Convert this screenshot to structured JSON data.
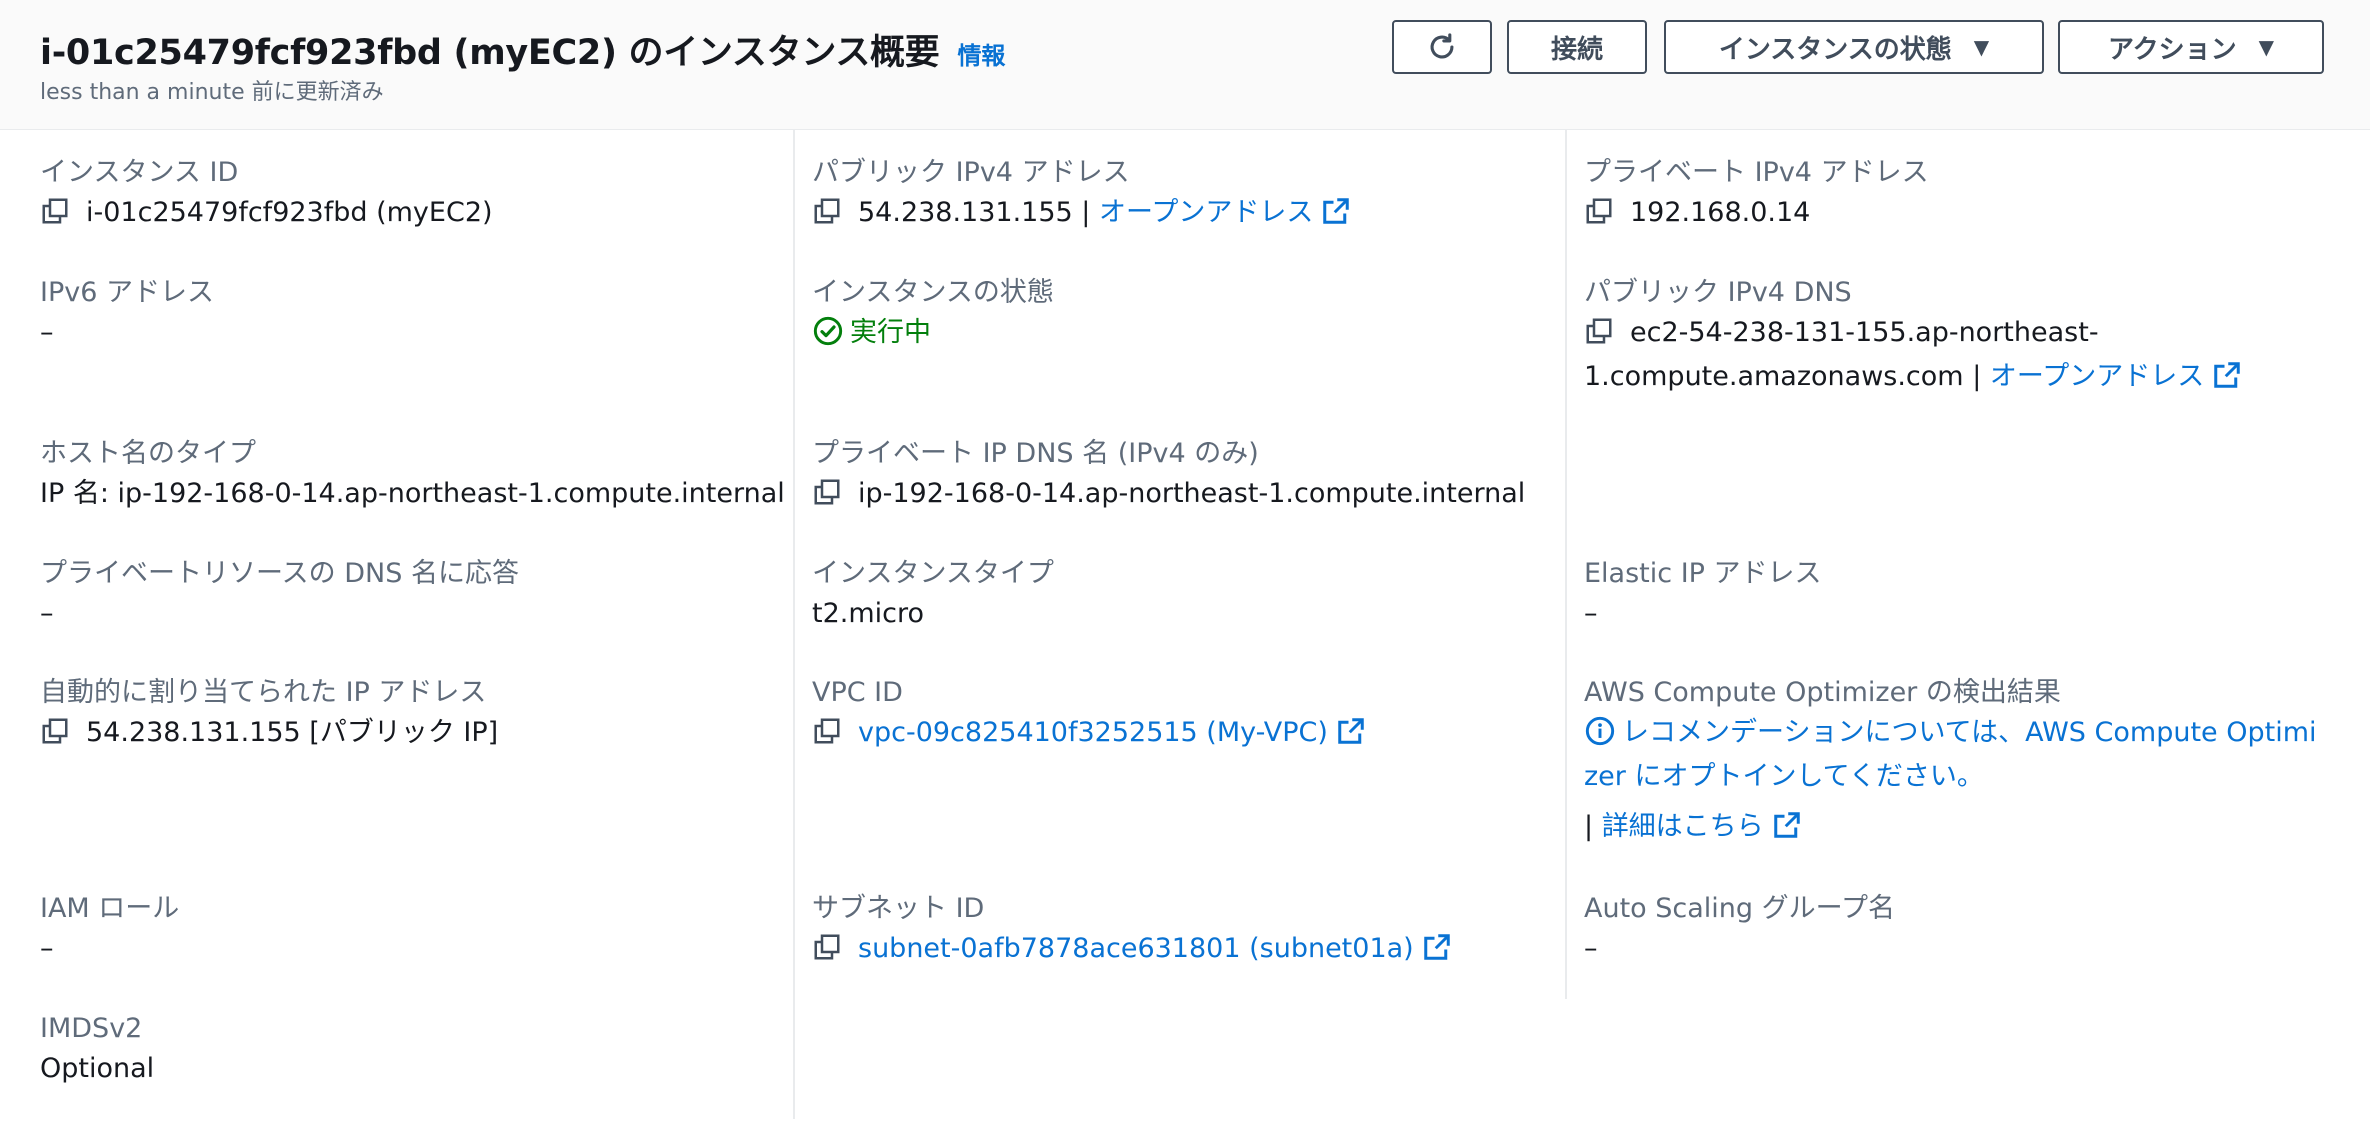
{
  "header": {
    "title": "i-01c25479fcf923fbd (myEC2) のインスタンス概要",
    "info": "情報",
    "updated": "less than a minute 前に更新済み",
    "buttons": {
      "connect": "接続",
      "instance_state": "インスタンスの状態",
      "actions": "アクション"
    }
  },
  "details": {
    "instance_id": {
      "label": "インスタンス ID",
      "value": "i-01c25479fcf923fbd (myEC2)"
    },
    "public_ipv4": {
      "label": "パブリック IPv4 アドレス",
      "value": "54.238.131.155",
      "sep": " | ",
      "link": "オープンアドレス"
    },
    "private_ipv4": {
      "label": "プライベート IPv4 アドレス",
      "value": "192.168.0.14"
    },
    "ipv6": {
      "label": "IPv6 アドレス",
      "value": "–"
    },
    "state": {
      "label": "インスタンスの状態",
      "value": "実行中"
    },
    "public_dns": {
      "label": "パブリック IPv4 DNS",
      "value_line1": "ec2-54-238-131-155.ap-northeast-",
      "value_line2": "1.compute.amazonaws.com",
      "sep": " | ",
      "link": "オープンアドレス"
    },
    "hostname_type": {
      "label": "ホスト名のタイプ",
      "value": "IP 名: ip-192-168-0-14.ap-northeast-1.compute.internal"
    },
    "private_dns": {
      "label": "プライベート IP DNS 名 (IPv4 のみ)",
      "value": "ip-192-168-0-14.ap-northeast-1.compute.internal"
    },
    "resource_dns": {
      "label": "プライベートリソースの DNS 名に応答",
      "value": "–"
    },
    "instance_type": {
      "label": "インスタンスタイプ",
      "value": "t2.micro"
    },
    "elastic_ip": {
      "label": "Elastic IP アドレス",
      "value": "–"
    },
    "auto_ip": {
      "label": "自動的に割り当てられた IP アドレス",
      "value": "54.238.131.155 [パブリック IP]"
    },
    "vpc_id": {
      "label": "VPC ID",
      "value": "vpc-09c825410f3252515 (My-VPC)"
    },
    "optimizer": {
      "label": "AWS Compute Optimizer の検出結果",
      "line1": "レコメンデーションについては、AWS Compute Optimi",
      "line2": "zer にオプトインしてください。",
      "pipe": "| ",
      "more": "詳細はこちら"
    },
    "iam_role": {
      "label": "IAM ロール",
      "value": "–"
    },
    "subnet_id": {
      "label": "サブネット ID",
      "value": "subnet-0afb7878ace631801 (subnet01a)"
    },
    "asg_name": {
      "label": "Auto Scaling グループ名",
      "value": "–"
    },
    "imdsv2": {
      "label": "IMDSv2",
      "value": "Optional"
    }
  },
  "colors": {
    "link": "#0972d3",
    "success": "#037f0c",
    "label": "#5f6b7a",
    "text": "#16191f"
  }
}
